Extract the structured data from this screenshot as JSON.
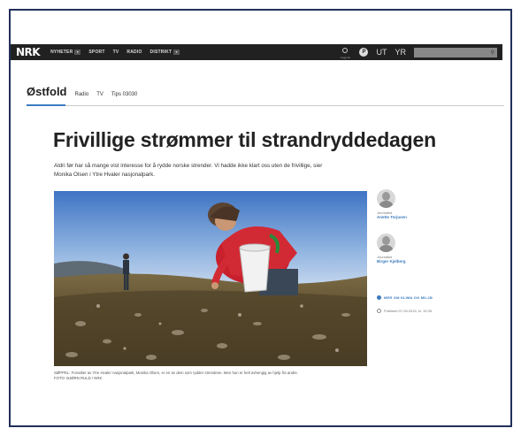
{
  "header": {
    "logo": "NRK",
    "nav": [
      {
        "label": "NYHETER",
        "has_menu": true
      },
      {
        "label": "SPORT",
        "has_menu": false
      },
      {
        "label": "TV",
        "has_menu": false
      },
      {
        "label": "RADIO",
        "has_menu": false
      },
      {
        "label": "DISTRIKT",
        "has_menu": true
      }
    ],
    "user_label": "Logg inn",
    "p3_label": "P",
    "ut_label": "UT",
    "yr_label": "YR",
    "search_icon": "search-icon"
  },
  "subnav": {
    "title": "Østfold",
    "links": [
      "Radio",
      "TV",
      "Tips 03030"
    ]
  },
  "article": {
    "headline": "Frivillige strømmer til strandryddedagen",
    "lead": "Aldri før har så mange vist interesse for å rydde norske strender. Vi hadde ikke klart oss uten de frivillige, sier Monika Olsen i Ytre Hvaler nasjonalpark.",
    "caption": "SØPPEL: Forvalter av Ytre Hvaler nasjonalpark, Monika Olsen, er en av dem som rydder strendene. Men hun er helt avhengig av hjelp fra andre.",
    "photo_credit": "FOTO: BJØRN RULD / NRK"
  },
  "authors": [
    {
      "role": "Journalist",
      "name": "Anette Torjusen"
    },
    {
      "role": "Journalist",
      "name": "Birger Kjelberg"
    }
  ],
  "more_link": "MER OM KLIMA OG MILJØ",
  "published": "Publisert 07.05.2015, kl. 19:35",
  "colors": {
    "accent": "#3c7bbf",
    "topbar": "#212121",
    "frame": "#22305a"
  }
}
